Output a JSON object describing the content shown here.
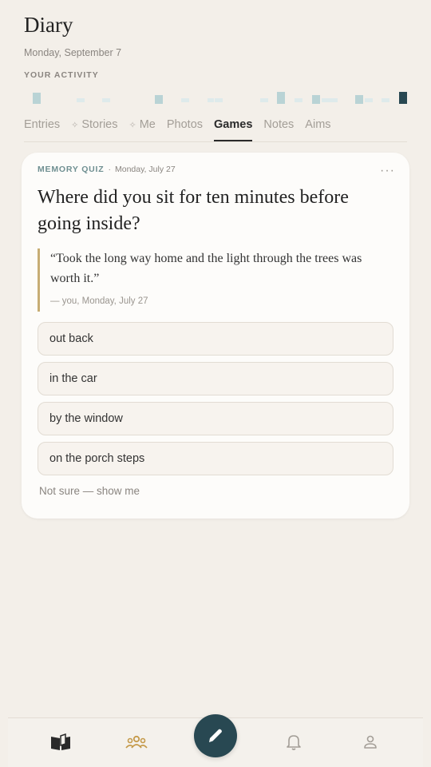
{
  "app": {
    "title": "Diary",
    "date": "Monday, September 7"
  },
  "activity": {
    "label": "YOUR ACTIVITY",
    "accent_color": "#284852",
    "light_color": "#b9d3d5",
    "pale_color": "#deeaeb"
  },
  "tabs": [
    {
      "label": "Entries",
      "icon": "",
      "active": false
    },
    {
      "label": "Stories",
      "icon": "sparkle-icon",
      "active": false
    },
    {
      "label": "Me",
      "icon": "sparkle-icon",
      "active": false
    },
    {
      "label": "Photos",
      "icon": "",
      "active": false
    },
    {
      "label": "Games",
      "icon": "",
      "active": true
    },
    {
      "label": "Notes",
      "icon": "",
      "active": false
    },
    {
      "label": "Aims",
      "icon": "",
      "active": false
    }
  ],
  "card": {
    "type_label": "MEMORY QUIZ",
    "separator": "·",
    "date": "Monday, July 27",
    "more_label": "···",
    "question": "Where did you sit for ten minutes before going inside?",
    "quote": "“Took the long way home and the light through the trees was worth it.”",
    "attribution": "— you, Monday, July 27",
    "options": [
      "out back",
      "in the car",
      "by the window",
      "on the porch steps"
    ],
    "not_sure": "Not sure — show me"
  },
  "bottom_nav": {
    "items": [
      "journal-icon",
      "community-icon",
      "notifications-icon",
      "profile-icon"
    ],
    "fab_icon": "pencil-icon",
    "colors": {
      "journal": "#2a2a2a",
      "community": "#c59a4a",
      "muted": "#a39e97"
    }
  }
}
